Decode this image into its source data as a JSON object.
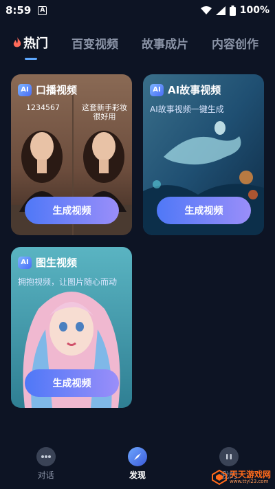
{
  "status_bar": {
    "time": "8:59",
    "notif_letter": "A",
    "battery": "100%"
  },
  "tabs": [
    {
      "label": "热门",
      "active": true
    },
    {
      "label": "百变视频",
      "active": false
    },
    {
      "label": "故事成片",
      "active": false
    },
    {
      "label": "内容创作",
      "active": false
    }
  ],
  "cards": [
    {
      "badge": "AI",
      "title": "口播视频",
      "overlay_left": "1234567",
      "overlay_right": "这套新手彩妆\n很好用",
      "button": "生成视频"
    },
    {
      "badge": "AI",
      "title": "AI故事视频",
      "subtitle": "AI故事视频一键生成",
      "button": "生成视频"
    },
    {
      "badge": "AI",
      "title": "图生视频",
      "subtitle": "拥抱视频，让图片随心而动",
      "button": "生成视频"
    }
  ],
  "bottom_nav": [
    {
      "label": "对话",
      "icon": "chat-icon"
    },
    {
      "label": "发现",
      "icon": "compass-icon",
      "active": true
    },
    {
      "label": "我的",
      "icon": "profile-icon"
    }
  ],
  "watermark": {
    "text": "天天游戏网",
    "url": "www.ttyl23.com"
  },
  "colors": {
    "background": "#0d1424",
    "button_gradient_start": "#4f78f7",
    "button_gradient_end": "#9a8ef9",
    "tab_inactive": "#8a93a6"
  }
}
